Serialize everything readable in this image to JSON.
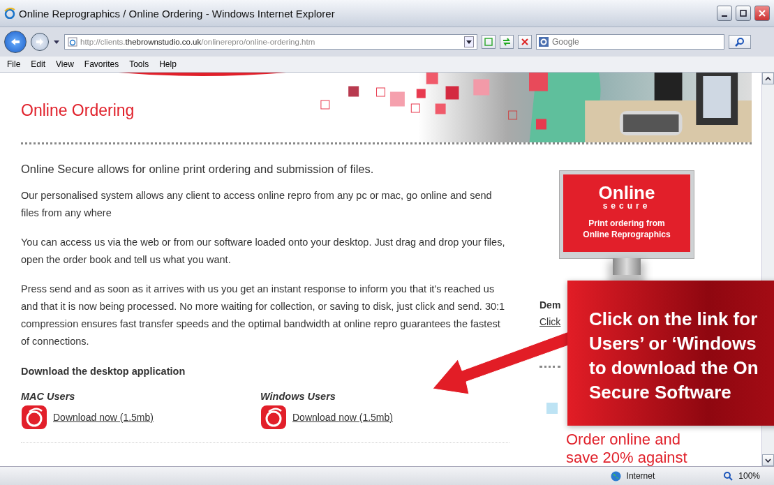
{
  "window": {
    "title": "Online Reprographics / Online Ordering - Windows Internet Explorer"
  },
  "address_bar": {
    "value": "http://clients.**thebrownstudio.co.uk**/onlinerepro/online-ordering.htm"
  },
  "search": {
    "placeholder": "Google"
  },
  "menu": [
    "File",
    "Edit",
    "View",
    "Favorites",
    "Tools",
    "Help"
  ],
  "page": {
    "title": "Online Ordering",
    "intro": "Online Secure allows for online print ordering and submission of files.",
    "paragraphs": [
      "Our personalised system allows any client to access online repro from any pc or mac, go online and send files from any where",
      "You can access us via the web or from our software loaded onto your desktop. Just drag and drop your files, open the order book and tell us what you want.",
      "Press send and as soon as it arrives with us you get an instant response to inform you that it's reached us and that it is now being processed. No more waiting for collection, or saving to disk, just click and send. 30:1 compression ensures fast transfer speeds and the optimal bandwidth at online repro guarantees the fastest of connections."
    ],
    "download_heading": "Download the desktop application",
    "downloads": [
      {
        "platform": "MAC Users",
        "link": "Download now (1.5mb)"
      },
      {
        "platform": "Windows Users",
        "link": "Download now (1.5mb)"
      }
    ]
  },
  "sidebar": {
    "monitor": {
      "logo": "Online",
      "logo_sub": "secure",
      "caption": "Print ordering from",
      "caption_2": "Online Reprographics"
    },
    "demo_heading": "Dem",
    "demo_link": "Click",
    "promo": [
      "Order online and",
      "save 20% against"
    ]
  },
  "callout": {
    "lines": [
      "Click on the link for",
      "Users’ or ‘Windows",
      "to download the On",
      "Secure Software"
    ]
  },
  "status_bar": {
    "zone": "Internet",
    "zoom": "100%"
  }
}
